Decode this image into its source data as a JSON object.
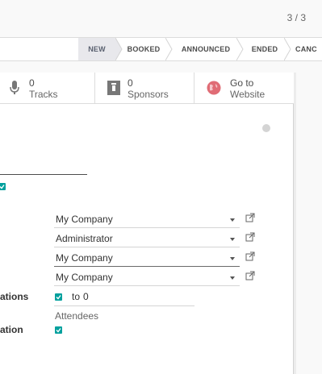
{
  "pager": {
    "text": "3 / 3"
  },
  "stages": [
    {
      "label": "NEW",
      "active": true
    },
    {
      "label": "BOOKED",
      "active": false
    },
    {
      "label": "ANNOUNCED",
      "active": false
    },
    {
      "label": "ENDED",
      "active": false
    },
    {
      "label": "CANC",
      "active": false
    }
  ],
  "smart_buttons": {
    "tracks": {
      "value": "0",
      "label": "Tracks"
    },
    "sponsors": {
      "value": "0",
      "label": "Sponsors"
    },
    "website": {
      "line1": "Go to",
      "line2": "Website"
    }
  },
  "fields": [
    {
      "value": "My Company"
    },
    {
      "value": "Administrator"
    },
    {
      "value": "My Company"
    },
    {
      "value": "My Company"
    }
  ],
  "labels": {
    "limit_registrations": "ations",
    "autoconfirm": "ation"
  },
  "limit": {
    "to_label": "to",
    "value": "0",
    "unit": "Attendees"
  },
  "colors": {
    "accent": "#00a09d",
    "website_icon": "#e06c75"
  }
}
